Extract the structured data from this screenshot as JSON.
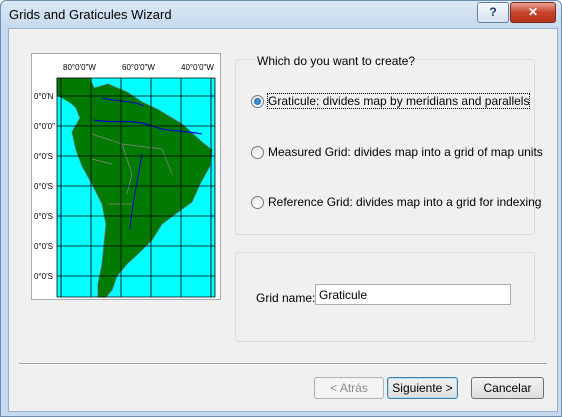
{
  "window": {
    "title": "Grids and Graticules Wizard",
    "help_label": "?",
    "close_label": "✕"
  },
  "map": {
    "top_labels": [
      "80°0'0\"W",
      "60°0'0\"W",
      "40°0'0\"W"
    ],
    "left_labels": [
      "0°0'N",
      "0°0'0\"",
      "0°0'S",
      "0°0'S",
      "0°0'S",
      "0°0'S",
      "0°0'S"
    ],
    "ocean_color": "#00ffff",
    "land_color": "#007a00",
    "grid_color": "#000000",
    "river_color": "#0000cc"
  },
  "create": {
    "question": "Which do you want to create?",
    "options": [
      {
        "label": "Graticule: divides map by meridians and parallels",
        "checked": true
      },
      {
        "label": "Measured Grid: divides map into a grid of map units",
        "checked": false
      },
      {
        "label": "Reference Grid: divides map into a grid for indexing",
        "checked": false
      }
    ]
  },
  "grid_name": {
    "label": "Grid name:",
    "value": "Graticule"
  },
  "buttons": {
    "back": "< Atrás",
    "next": "Siguiente >",
    "cancel": "Cancelar"
  }
}
